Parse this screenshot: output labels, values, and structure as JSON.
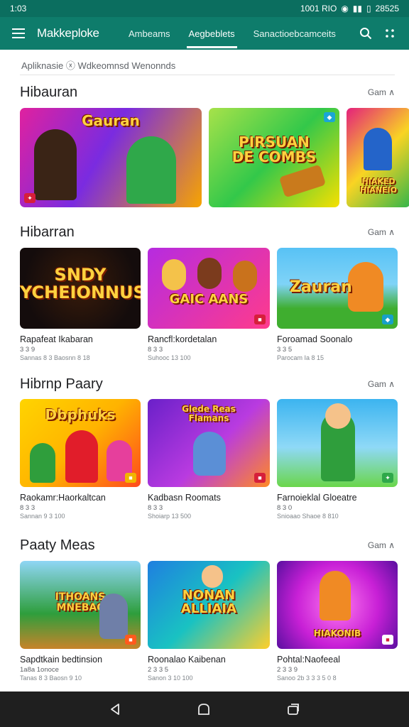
{
  "status": {
    "time": "1:03",
    "right_text": "1001 RIO",
    "battery": "28525"
  },
  "appbar": {
    "title": "Makkeploke",
    "tabs": [
      "Ambeams",
      "Aegbeblets",
      "Sanactioebcamceits"
    ]
  },
  "search": {
    "text": "Apliknasie  ⓧ  Wdkeomnsd  Wenonnds"
  },
  "sections": [
    {
      "title": "Hibauran",
      "more": "Gam ∧"
    },
    {
      "title": "Hibarran",
      "more": "Gam ∧"
    },
    {
      "title": "Hibrnp Paary",
      "more": "Gam ∧"
    },
    {
      "title": "Paaty Meas",
      "more": "Gam ∧"
    }
  ],
  "featured": [
    {
      "art": "Gauran",
      "colors": [
        "#e0219f",
        "#f7a400"
      ]
    },
    {
      "art": "PIRSUAN\nDE COMBS",
      "colors": [
        "#33c84a",
        "#f6e000"
      ]
    },
    {
      "art": "HIAKED\nHIANEIO",
      "colors": [
        "#e4207c",
        "#33b54a"
      ]
    }
  ],
  "games": [
    {
      "art": "SNDY\nYCHEIONNUS",
      "name": "Rapafeat Ikabaran",
      "rating": "3 3 9",
      "meta": "Sannas 8 3 Baosnn 8 18",
      "colors": [
        "#140c0c",
        "#3a1c0a"
      ]
    },
    {
      "art": "GAIC AANS",
      "name": "Rancfl:kordetalan",
      "rating": "8 3 3",
      "meta": "Suhooc 13 100",
      "colors": [
        "#b62be0",
        "#ff3b8c"
      ]
    },
    {
      "art": "Zauran",
      "name": "Foroamad Soonalo",
      "rating": "3 3 5",
      "meta": "Parocam Ia 8 15",
      "colors": [
        "#58c2f5",
        "#3fae2f"
      ]
    },
    {
      "art": "Dbphuks",
      "name": "Raokamr:Haorkaltcan",
      "rating": "8 3 3",
      "meta": "Sannan 9 3 100",
      "colors": [
        "#ffb300",
        "#ff4a1d"
      ]
    },
    {
      "art": "Glede Reas\nFlamans",
      "name": "Kadbasn  Roomats",
      "rating": "8 3 3",
      "meta": "Shoiarp 13 500",
      "colors": [
        "#6a20c9",
        "#ff8a24"
      ]
    },
    {
      "art": "",
      "name": "Farnoieklal Gloeatre",
      "rating": "8 3 0",
      "meta": "Snioaao Shaoe 8 810",
      "colors": [
        "#3cb4f0",
        "#6ad64a"
      ]
    },
    {
      "art": "ITHOANS\nMNEBAC",
      "name": "Sapdtkain bedtinsion",
      "rating": "1a8a 1onoce",
      "meta": "Tanas 8 3 Baosn 9 10",
      "colors": [
        "#2e9e3c",
        "#ffb400"
      ]
    },
    {
      "art": "NONAN\nALLIAIA",
      "name": "Roonalao Kaibenan",
      "rating": "2 3 3 5",
      "meta": "Sanon 3 10 100",
      "colors": [
        "#1f7fe0",
        "#ffcf2b"
      ]
    },
    {
      "art": "HIAKONIB",
      "name": "Pohtal:Naofeeal",
      "rating": "2 3 3 9",
      "meta": "Sanoo 2b 3 3 3 5 0 8",
      "colors": [
        "#c820d6",
        "#ffd400"
      ]
    }
  ]
}
